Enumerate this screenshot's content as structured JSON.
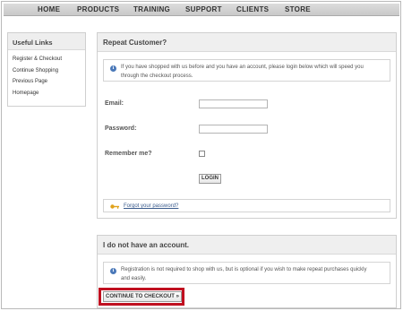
{
  "nav": {
    "items": [
      "HOME",
      "PRODUCTS",
      "TRAINING",
      "SUPPORT",
      "CLIENTS",
      "STORE"
    ]
  },
  "sidebar": {
    "title": "Useful Links",
    "items": [
      "Register & Checkout",
      "Continue Shopping",
      "Previous Page",
      "Homepage"
    ]
  },
  "repeat": {
    "title": "Repeat Customer?",
    "info_line1": "If you have shopped with us before and you have an account, please login below which will speed you",
    "info_line2": "through the checkout process.",
    "email_label": "Email:",
    "password_label": "Password:",
    "remember_label": "Remember me?",
    "email_value": "",
    "password_value": "",
    "remember_checked": false,
    "login_label": "LOGIN",
    "forgot_label": "Forgot your password?"
  },
  "new_account": {
    "title": "I do not have an account.",
    "info_line1": "Registration is not required to shop with us, but is optional if you wish to make repeat purchases quickly",
    "info_line2": "and easily.",
    "continue_label": "CONTINUE TO CHECKOUT »"
  },
  "colors": {
    "highlight": "#c01020",
    "info_icon": "#4a78b8",
    "key_icon": "#e0a21b"
  }
}
